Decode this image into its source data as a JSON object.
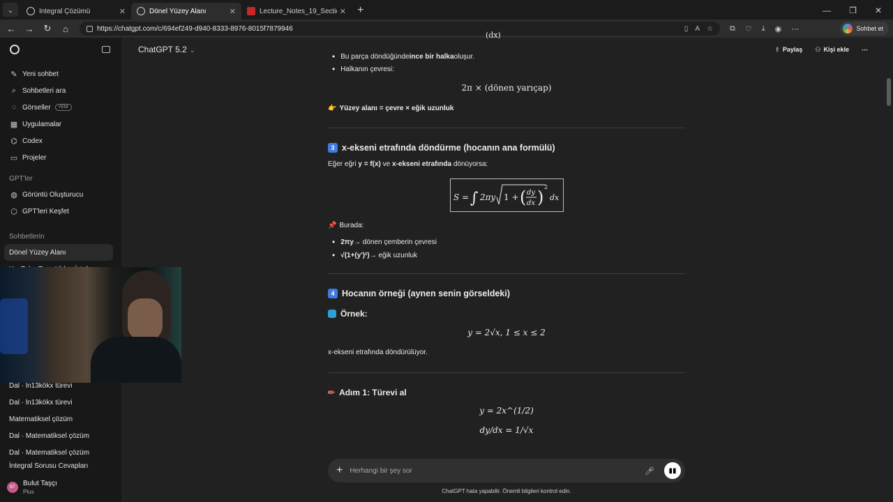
{
  "browser": {
    "tabs": [
      {
        "title": "İntegral Çözümü",
        "active": false
      },
      {
        "title": "Dönel Yüzey Alanı",
        "active": true
      },
      {
        "title": "Lecture_Notes_19_Section_2.pdf",
        "active": false
      }
    ],
    "url": "https://chatgpt.com/c/694ef249-d940-8333-8976-8015f7879946",
    "profile_label": "Sohbet et"
  },
  "sidebar": {
    "items": [
      {
        "icon": "new-chat-icon",
        "label": "Yeni sohbet"
      },
      {
        "icon": "search-icon",
        "label": "Sohbetleri ara"
      },
      {
        "icon": "image-icon",
        "label": "Görseller",
        "badge": "YENİ"
      },
      {
        "icon": "apps-icon",
        "label": "Uygulamalar"
      },
      {
        "icon": "codex-icon",
        "label": "Codex"
      },
      {
        "icon": "folder-icon",
        "label": "Projeler"
      }
    ],
    "gpts_head": "GPT'ler",
    "gpts": [
      {
        "label": "Görüntü Oluşturucu"
      },
      {
        "label": "GPT'leri Keşfet"
      }
    ],
    "chats_head": "Sohbetlerin",
    "chats_top": [
      {
        "label": "Dönel Yüzey Alanı",
        "active": true
      },
      {
        "label": "YouTube Tarzı Video İstek"
      }
    ],
    "chats_bottom": [
      {
        "label": "Dal · ln13kökx türevi"
      },
      {
        "label": "Dal · ln13kökx türevi"
      },
      {
        "label": "Matematiksel çözüm"
      },
      {
        "label": "Dal · Matematiksel çözüm"
      },
      {
        "label": "Dal · Matematiksel çözüm"
      },
      {
        "label": "İntegral Sorusu Cevapları"
      }
    ],
    "user": {
      "name": "Bulut Taşçı",
      "plan": "Plus",
      "initials": "BT"
    }
  },
  "header": {
    "model": "ChatGPT 5.2",
    "share": "Paylaş",
    "add_person": "Kişi ekle"
  },
  "message": {
    "bullet1_pre": "Bu parça döndüğünde ",
    "bullet1_bold": "ince bir halka",
    "bullet1_post": " oluşur.",
    "bullet2": "Halkanın çevresi:",
    "formula_circ": "2π × (dönen yarıçap)",
    "surface_note": "Yüzey alanı = çevre × eğik uzunluk",
    "section3_num": "3",
    "section3_title": "x-ekseni etrafında döndürme (hocanın ana formülü)",
    "s3_intro_a": "Eğer eğri ",
    "s3_intro_b": "y = f(x)",
    "s3_intro_c": " ve ",
    "s3_intro_d": "x-ekseni etrafında",
    "s3_intro_e": " dönüyorsa:",
    "main_formula": "S = ∫ 2πy √(1 + (dy/dx)²) dx",
    "burada": "Burada:",
    "b1_bold": "2πy",
    "b1_rest": " → dönen çemberin çevresi",
    "b2_bold": "√(1+(y')²)",
    "b2_rest": " → eğik uzunluk",
    "section4_num": "4",
    "section4_title": "Hocanın örneği (aynen senin görseldeki)",
    "example_label": "Örnek:",
    "example_formula": "y = 2√x,    1 ≤ x ≤ 2",
    "rotated": "x-ekseni etrafında döndürülüyor.",
    "step1_title": "Adım 1: Türevi al",
    "step1_f1": "y = 2x^(1/2)",
    "step1_f2": "dy/dx = 1/√x"
  },
  "composer": {
    "placeholder": "Herhangi bir şey sor"
  },
  "footer": "ChatGPT hata yapabilir. Önemli bilgileri kontrol edin."
}
